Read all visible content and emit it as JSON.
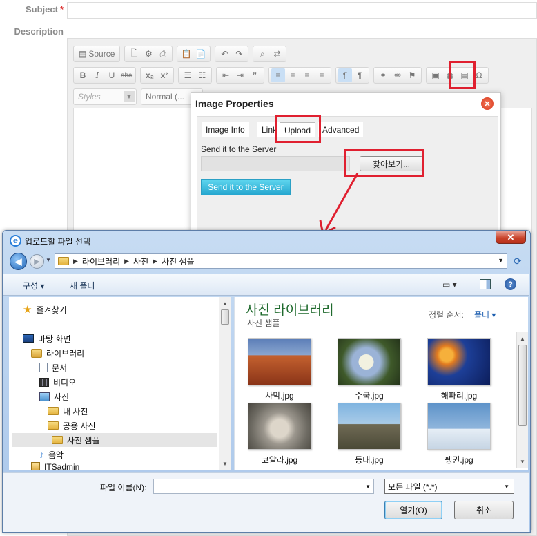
{
  "form": {
    "subject_label": "Subject",
    "required_mark": "*",
    "description_label": "Description"
  },
  "editor_toolbar": {
    "source_label": "Source",
    "bold": "B",
    "italic": "I",
    "underline": "U",
    "strike": "abc",
    "subscript": "x₂",
    "superscript": "x²",
    "styles_placeholder": "Styles",
    "format_value": "Normal (..."
  },
  "image_dialog": {
    "title": "Image Properties",
    "tabs": [
      "Image Info",
      "Link",
      "Upload",
      "Advanced"
    ],
    "active_tab": "Upload",
    "send_label": "Send it to the Server",
    "browse_button": "찾아보기...",
    "send_button": "Send it to the Server"
  },
  "file_dialog": {
    "title": "업로드할 파일 선택",
    "breadcrumb": [
      "라이브러리",
      "사진",
      "사진 샘플"
    ],
    "commands": {
      "organize": "구성",
      "new_folder": "새 폴더"
    },
    "nav_items": [
      {
        "label": "즐겨찾기",
        "icon": "star-icon"
      },
      {
        "label": "바탕 화면",
        "icon": "desktop-icon"
      },
      {
        "label": "라이브러리",
        "icon": "library-icon"
      },
      {
        "label": "문서",
        "icon": "document-icon"
      },
      {
        "label": "비디오",
        "icon": "video-icon"
      },
      {
        "label": "사진",
        "icon": "pictures-icon"
      },
      {
        "label": "내 사진",
        "icon": "folder-icon"
      },
      {
        "label": "공용 사진",
        "icon": "folder-icon"
      },
      {
        "label": "사진 샘플",
        "icon": "folder-icon",
        "selected": true
      },
      {
        "label": "음악",
        "icon": "music-icon"
      },
      {
        "label": "ITSadmin",
        "icon": "user-folder-icon"
      }
    ],
    "library_title": "사진 라이브러리",
    "library_subtitle": "사진 샘플",
    "sort_label": "정렬 순서:",
    "sort_value": "폴더",
    "files": [
      {
        "name": "사막.jpg",
        "color": "#b5542a"
      },
      {
        "name": "수국.jpg",
        "color": "#5f7f45"
      },
      {
        "name": "해파리.jpg",
        "color": "#1a3f8f"
      },
      {
        "name": "코알라.jpg",
        "color": "#8e8c86"
      },
      {
        "name": "등대.jpg",
        "color": "#6a9ec8"
      },
      {
        "name": "펭귄.jpg",
        "color": "#6f9cc9"
      }
    ],
    "filename_label": "파일 이름(N):",
    "filename_value": "",
    "filetype_value": "모든 파일 (*.*)",
    "open_button": "열기(O)",
    "cancel_button": "취소"
  },
  "colors": {
    "highlight": "#e02030",
    "send_button": "#2fb3dc",
    "library_title": "#1f6a2d"
  }
}
